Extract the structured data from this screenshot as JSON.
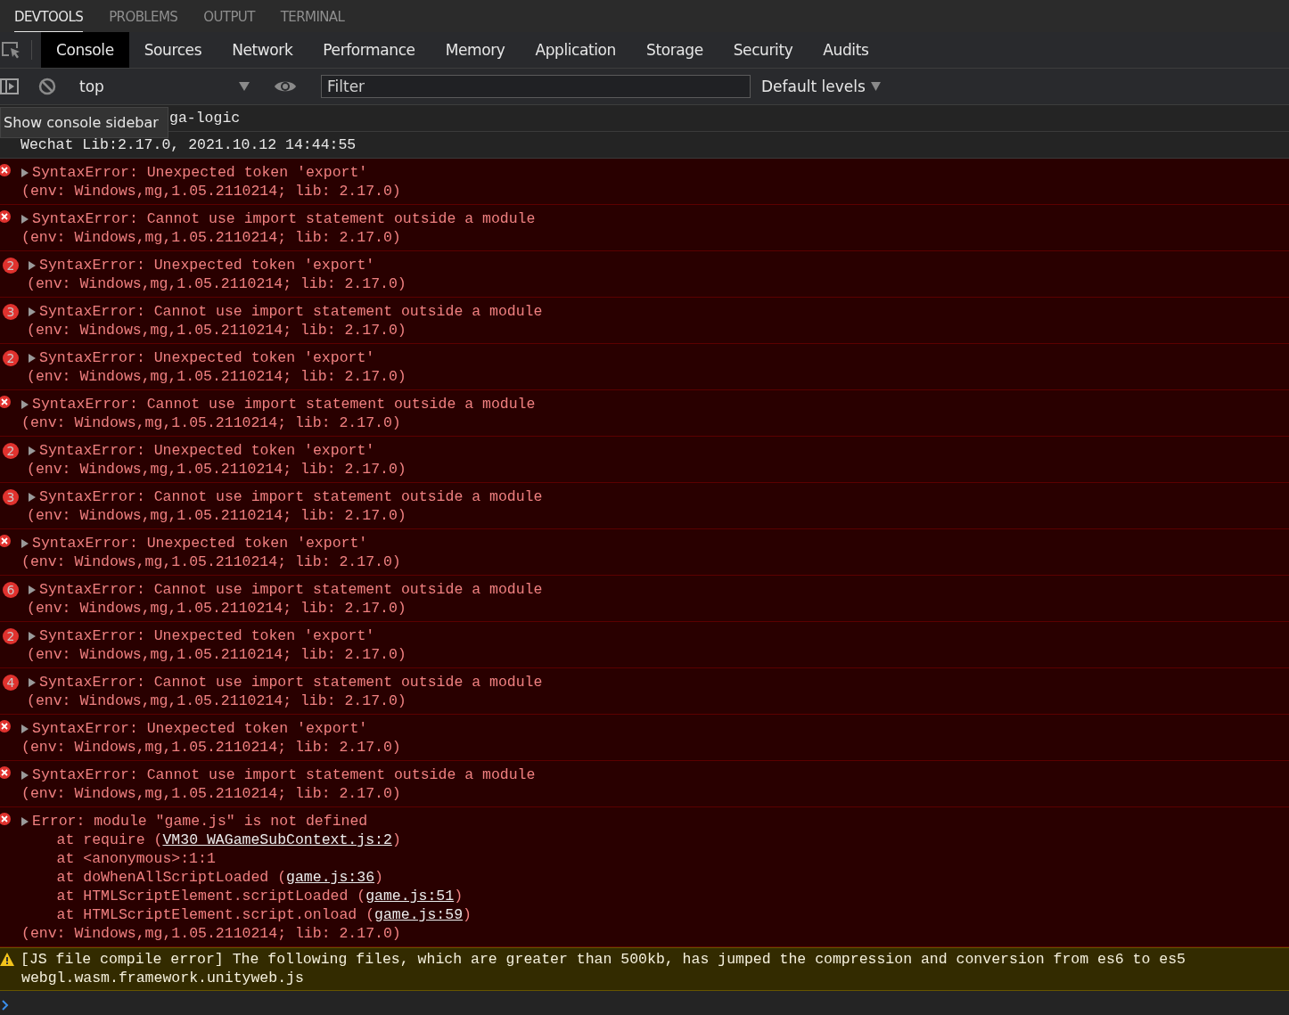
{
  "drawer_tabs": [
    {
      "label": "DEVTOOLS",
      "selected": true
    },
    {
      "label": "PROBLEMS",
      "selected": false
    },
    {
      "label": "OUTPUT",
      "selected": false
    },
    {
      "label": "TERMINAL",
      "selected": false
    }
  ],
  "panel_tabs": [
    {
      "label": "Console",
      "selected": true
    },
    {
      "label": "Sources",
      "selected": false
    },
    {
      "label": "Network",
      "selected": false
    },
    {
      "label": "Performance",
      "selected": false
    },
    {
      "label": "Memory",
      "selected": false
    },
    {
      "label": "Application",
      "selected": false
    },
    {
      "label": "Storage",
      "selected": false
    },
    {
      "label": "Security",
      "selected": false
    },
    {
      "label": "Audits",
      "selected": false
    }
  ],
  "toolbar": {
    "context": "top",
    "filter_placeholder": "Filter",
    "levels": "Default levels"
  },
  "tooltip": "Show console sidebar",
  "messages": [
    {
      "kind": "info",
      "text": "ga-logic"
    },
    {
      "kind": "info",
      "text": "Wechat Lib:2.17.0, 2021.10.12 14:44:55"
    },
    {
      "kind": "error",
      "text": "SyntaxError: Unexpected token 'export'",
      "env": "(env: Windows,mg,1.05.2110214; lib: 2.17.0)"
    },
    {
      "kind": "error",
      "text": "SyntaxError: Cannot use import statement outside a module",
      "env": "(env: Windows,mg,1.05.2110214; lib: 2.17.0)"
    },
    {
      "kind": "error",
      "count": "2",
      "text": "SyntaxError: Unexpected token 'export'",
      "env": "(env: Windows,mg,1.05.2110214; lib: 2.17.0)"
    },
    {
      "kind": "error",
      "count": "3",
      "text": "SyntaxError: Cannot use import statement outside a module",
      "env": "(env: Windows,mg,1.05.2110214; lib: 2.17.0)"
    },
    {
      "kind": "error",
      "count": "2",
      "text": "SyntaxError: Unexpected token 'export'",
      "env": "(env: Windows,mg,1.05.2110214; lib: 2.17.0)"
    },
    {
      "kind": "error",
      "text": "SyntaxError: Cannot use import statement outside a module",
      "env": "(env: Windows,mg,1.05.2110214; lib: 2.17.0)"
    },
    {
      "kind": "error",
      "count": "2",
      "text": "SyntaxError: Unexpected token 'export'",
      "env": "(env: Windows,mg,1.05.2110214; lib: 2.17.0)"
    },
    {
      "kind": "error",
      "count": "3",
      "text": "SyntaxError: Cannot use import statement outside a module",
      "env": "(env: Windows,mg,1.05.2110214; lib: 2.17.0)"
    },
    {
      "kind": "error",
      "text": "SyntaxError: Unexpected token 'export'",
      "env": "(env: Windows,mg,1.05.2110214; lib: 2.17.0)"
    },
    {
      "kind": "error",
      "count": "6",
      "text": "SyntaxError: Cannot use import statement outside a module",
      "env": "(env: Windows,mg,1.05.2110214; lib: 2.17.0)"
    },
    {
      "kind": "error",
      "count": "2",
      "text": "SyntaxError: Unexpected token 'export'",
      "env": "(env: Windows,mg,1.05.2110214; lib: 2.17.0)"
    },
    {
      "kind": "error",
      "count": "4",
      "text": "SyntaxError: Cannot use import statement outside a module",
      "env": "(env: Windows,mg,1.05.2110214; lib: 2.17.0)"
    },
    {
      "kind": "error",
      "text": "SyntaxError: Unexpected token 'export'",
      "env": "(env: Windows,mg,1.05.2110214; lib: 2.17.0)"
    },
    {
      "kind": "error",
      "text": "SyntaxError: Cannot use import statement outside a module",
      "env": "(env: Windows,mg,1.05.2110214; lib: 2.17.0)"
    },
    {
      "kind": "error",
      "text": "Error: module \"game.js\" is not defined",
      "stack": [
        {
          "prefix": "at require (",
          "link": "VM30 WAGameSubContext.js:2",
          "suffix": ")"
        },
        {
          "prefix": "at <anonymous>:1:1"
        },
        {
          "prefix": "at doWhenAllScriptLoaded (",
          "link": "game.js:36",
          "suffix": ")"
        },
        {
          "prefix": "at HTMLScriptElement.scriptLoaded (",
          "link": "game.js:51",
          "suffix": ")"
        },
        {
          "prefix": "at HTMLScriptElement.script.onload (",
          "link": "game.js:59",
          "suffix": ")"
        }
      ],
      "env": "(env: Windows,mg,1.05.2110214; lib: 2.17.0)"
    },
    {
      "kind": "warning",
      "text": "[JS file compile error] The following files, which are greater than 500kb, has jumped the compression and conversion from es6 to es5",
      "detail": "webgl.wasm.framework.unityweb.js"
    }
  ]
}
